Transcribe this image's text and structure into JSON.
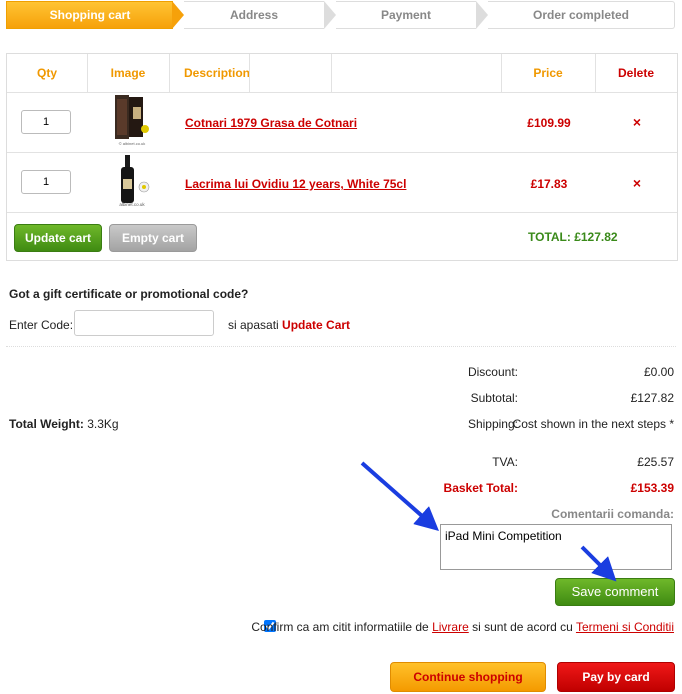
{
  "steps": [
    "Shopping cart",
    "Address",
    "Payment",
    "Order completed"
  ],
  "table": {
    "headers": {
      "qty": "Qty",
      "image": "Image",
      "description": "Description",
      "price": "Price",
      "delete": "Delete"
    },
    "items": [
      {
        "qty": "1",
        "name": "Cotnari 1979 Grasa de Cotnari",
        "price": "£109.99",
        "delete_icon": "×",
        "image_watermark": "© albinet.co.uk"
      },
      {
        "qty": "1",
        "name": "Lacrima lui Ovidiu 12 years, White 75cl",
        "price": "£17.83",
        "delete_icon": "×",
        "image_watermark": "albinet.co.uk"
      }
    ],
    "update_label": "Update cart",
    "empty_label": "Empty cart",
    "total": "TOTAL: £127.82"
  },
  "promo": {
    "title": "Got a gift certificate or promotional code?",
    "label": "Enter Code:",
    "input_value": "",
    "note_prefix": "si apasati",
    "note_link": "Update Cart"
  },
  "summary": {
    "discount_label": "Discount:",
    "discount": "£0.00",
    "subtotal_label": "Subtotal:",
    "subtotal": "£127.82",
    "shipping_label": "Shipping:",
    "shipping": "Cost shown in the next steps *",
    "weight_label": "Total Weight:",
    "weight": "3.3Kg",
    "tva_label": "TVA:",
    "tva": "£25.57",
    "basket_label": "Basket Total:",
    "basket": "£153.39"
  },
  "comments": {
    "label": "Comentarii comanda:",
    "value": "iPad Mini Competition",
    "save_label": "Save comment"
  },
  "confirm": {
    "text1": "Confirm ca am citit informatiile de",
    "link1": "Livrare",
    "text2": "si sunt de acord cu",
    "link2": "Termeni si Conditii",
    "checked": true
  },
  "actions": {
    "continue_label": "Continue shopping",
    "pay_label": "Pay by card"
  },
  "colors": {
    "accent": "#f6a10a",
    "price_red": "#cc0000",
    "total_green": "#3a8a1a",
    "arrow_blue": "#1a3de0"
  }
}
